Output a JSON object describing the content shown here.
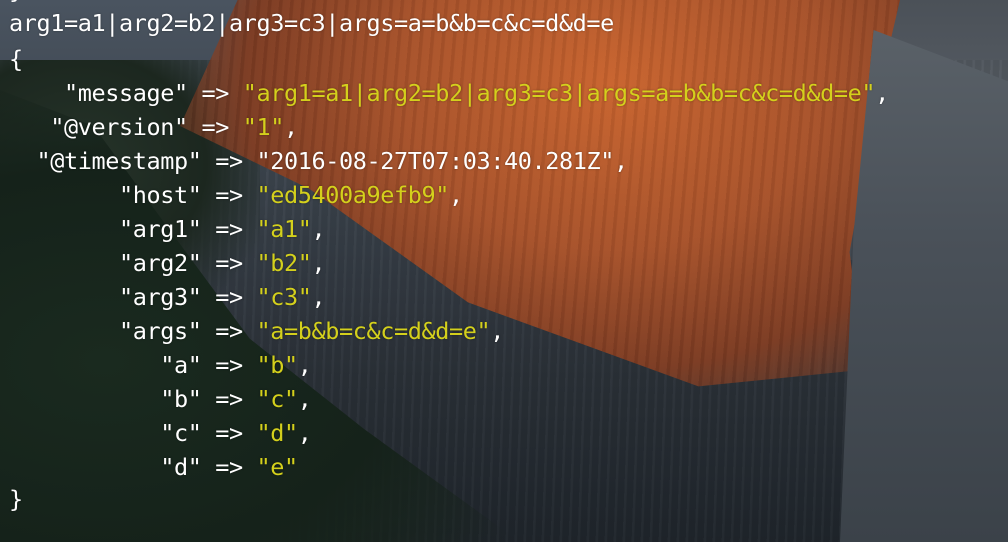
{
  "terminal": {
    "header_line": "arg1=a1|arg2=b2|arg3=c3|args=a=b&b=c&c=d&d=e",
    "open_brace": "{",
    "close_brace": "}",
    "cut_off_top": "}",
    "arrow": "=>",
    "entries": [
      {
        "key": "\"message\"",
        "value": "\"arg1=a1|arg2=b2|arg3=c3|args=a=b&b=c&c=d&d=e\"",
        "trail": ",",
        "indent": "    ",
        "value_color": "yellow"
      },
      {
        "key": "\"@version\"",
        "value": "\"1\"",
        "trail": ",",
        "indent": "   ",
        "value_color": "yellow"
      },
      {
        "key": "\"@timestamp\"",
        "value": "\"2016-08-27T07:03:40.281Z\"",
        "trail": ",",
        "indent": "  ",
        "value_color": "white"
      },
      {
        "key": "\"host\"",
        "value": "\"ed5400a9efb9\"",
        "trail": ",",
        "indent": "        ",
        "value_color": "yellow"
      },
      {
        "key": "\"arg1\"",
        "value": "\"a1\"",
        "trail": ",",
        "indent": "        ",
        "value_color": "yellow"
      },
      {
        "key": "\"arg2\"",
        "value": "\"b2\"",
        "trail": ",",
        "indent": "        ",
        "value_color": "yellow"
      },
      {
        "key": "\"arg3\"",
        "value": "\"c3\"",
        "trail": ",",
        "indent": "        ",
        "value_color": "yellow"
      },
      {
        "key": "\"args\"",
        "value": "\"a=b&b=c&c=d&d=e\"",
        "trail": ",",
        "indent": "        ",
        "value_color": "yellow"
      },
      {
        "key": "\"a\"",
        "value": "\"b\"",
        "trail": ",",
        "indent": "           ",
        "value_color": "yellow"
      },
      {
        "key": "\"b\"",
        "value": "\"c\"",
        "trail": ",",
        "indent": "           ",
        "value_color": "yellow"
      },
      {
        "key": "\"c\"",
        "value": "\"d\"",
        "trail": ",",
        "indent": "           ",
        "value_color": "yellow"
      },
      {
        "key": "\"d\"",
        "value": "\"e\"",
        "trail": "",
        "indent": "           ",
        "value_color": "yellow"
      }
    ]
  },
  "colors": {
    "text_white": "#ffffff",
    "value_yellow": "#d4d01c"
  }
}
